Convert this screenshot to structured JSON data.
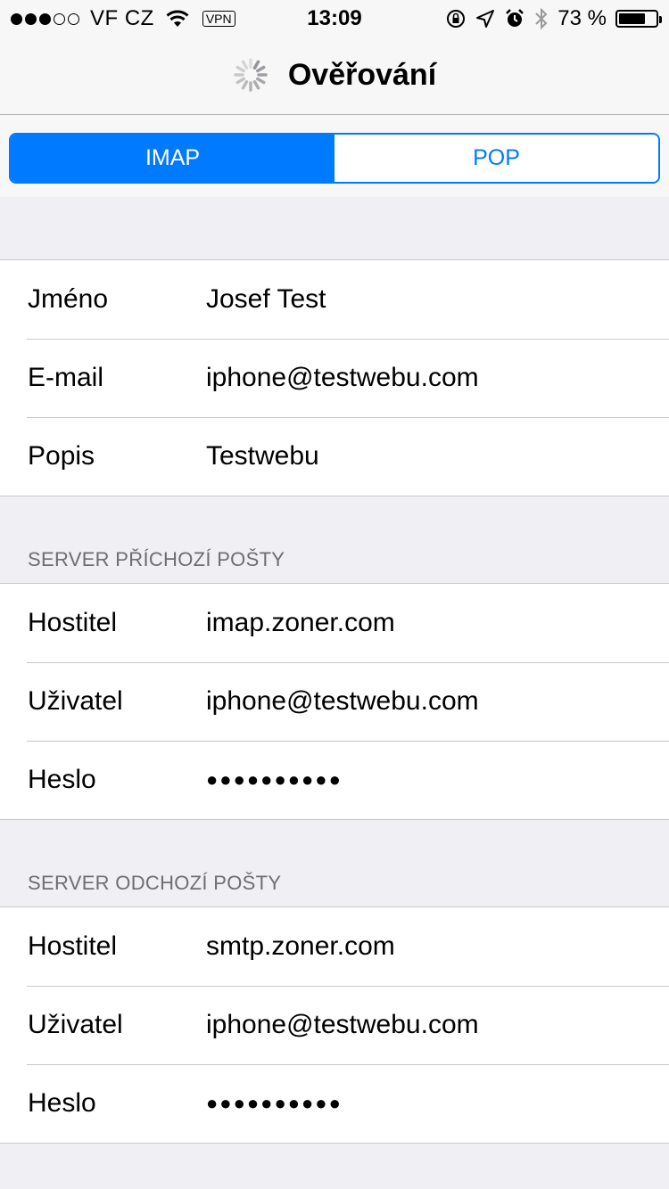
{
  "status_bar": {
    "carrier": "VF CZ",
    "vpn": "VPN",
    "time": "13:09",
    "battery_percent": "73 %",
    "battery_level": 0.73
  },
  "nav": {
    "title": "Ověřování"
  },
  "segments": {
    "imap": "IMAP",
    "pop": "POP",
    "selected": "IMAP"
  },
  "account": {
    "rows": [
      {
        "label": "Jméno",
        "value": "Josef Test"
      },
      {
        "label": "E-mail",
        "value": "iphone@testwebu.com"
      },
      {
        "label": "Popis",
        "value": "Testwebu"
      }
    ]
  },
  "incoming": {
    "header": "SERVER PŘÍCHOZÍ POŠTY",
    "rows": [
      {
        "label": "Hostitel",
        "value": "imap.zoner.com"
      },
      {
        "label": "Uživatel",
        "value": "iphone@testwebu.com"
      },
      {
        "label": "Heslo",
        "value": "●●●●●●●●●●"
      }
    ]
  },
  "outgoing": {
    "header": "SERVER ODCHOZÍ POŠTY",
    "rows": [
      {
        "label": "Hostitel",
        "value": "smtp.zoner.com"
      },
      {
        "label": "Uživatel",
        "value": "iphone@testwebu.com"
      },
      {
        "label": "Heslo",
        "value": "●●●●●●●●●●"
      }
    ]
  },
  "colors": {
    "accent": "#007aff",
    "background": "#efeff4"
  }
}
